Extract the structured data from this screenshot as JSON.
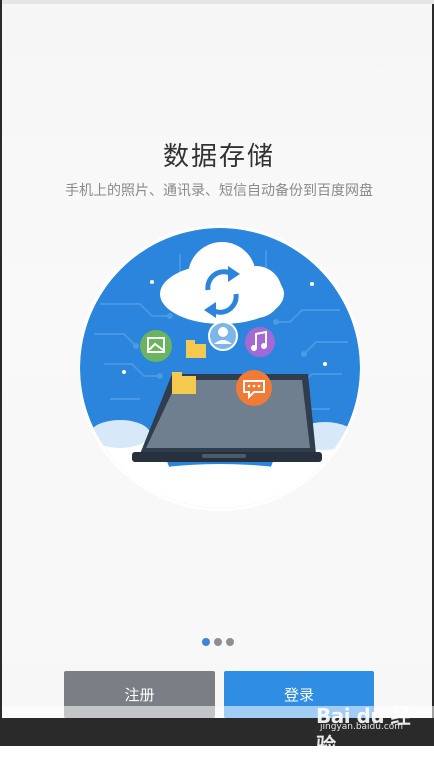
{
  "onboarding": {
    "title": "数据存储",
    "subtitle": "手机上的照片、通讯录、短信自动备份到百度网盘",
    "page_indicator": {
      "total": 3,
      "active_index": 0
    }
  },
  "buttons": {
    "register_label": "注册",
    "login_label": "登录"
  },
  "watermark": {
    "logo_text": "Bai du 经验",
    "url": "jingyan.baidu.com"
  },
  "colors": {
    "primary_blue": "#2f8ee4",
    "register_gray": "#7a7f86",
    "circle_blue": "#2b85dc"
  },
  "icons": [
    "cloud-sync-icon",
    "photo-icon",
    "folder-icon",
    "contact-icon",
    "music-icon",
    "message-icon",
    "tablet-icon"
  ]
}
